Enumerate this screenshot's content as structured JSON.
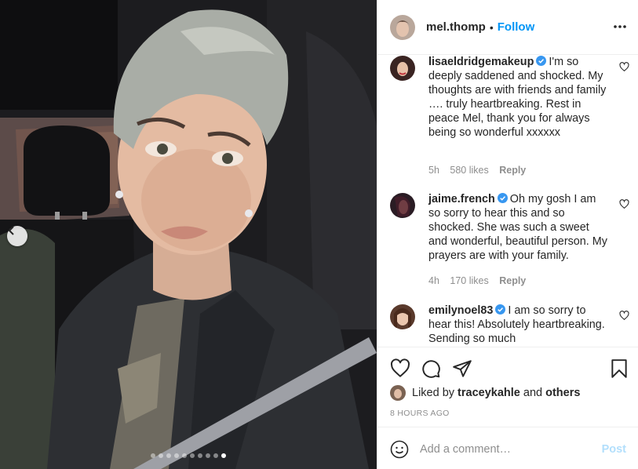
{
  "header": {
    "username": "mel.thomp",
    "separator": "•",
    "follow_label": "Follow"
  },
  "comments": [
    {
      "username": "lisaeldridgemakeup",
      "verified": true,
      "text": "I'm so deeply saddened and shocked. My thoughts are with friends and family …. truly heartbreaking. Rest in peace Mel, thank you for always being so wonderful xxxxxx",
      "time": "5h",
      "likes": "580 likes",
      "reply_label": "Reply"
    },
    {
      "username": "jaime.french",
      "verified": true,
      "text": "Oh my gosh I am so sorry to hear this and so shocked. She was such a sweet and wonderful, beautiful person. My prayers are with your family.",
      "time": "4h",
      "likes": "170 likes",
      "reply_label": "Reply"
    },
    {
      "username": "emilynoel83",
      "verified": true,
      "text": "I am so sorry to hear this! Absolutely heartbreaking. Sending so much",
      "time": "",
      "likes": "",
      "reply_label": ""
    }
  ],
  "liked_by": {
    "prefix": "Liked by",
    "user": "traceykahle",
    "and": "and",
    "others": "others"
  },
  "time_ago": "8 HOURS AGO",
  "composer": {
    "placeholder": "Add a comment…",
    "post_label": "Post"
  },
  "carousel": {
    "total_slides": 10,
    "active_index": 9
  },
  "colors": {
    "link_blue": "#0095f6",
    "post_disabled": "#b2dffc",
    "meta_gray": "#8e8e8e",
    "verified_blue": "#3897f0"
  }
}
